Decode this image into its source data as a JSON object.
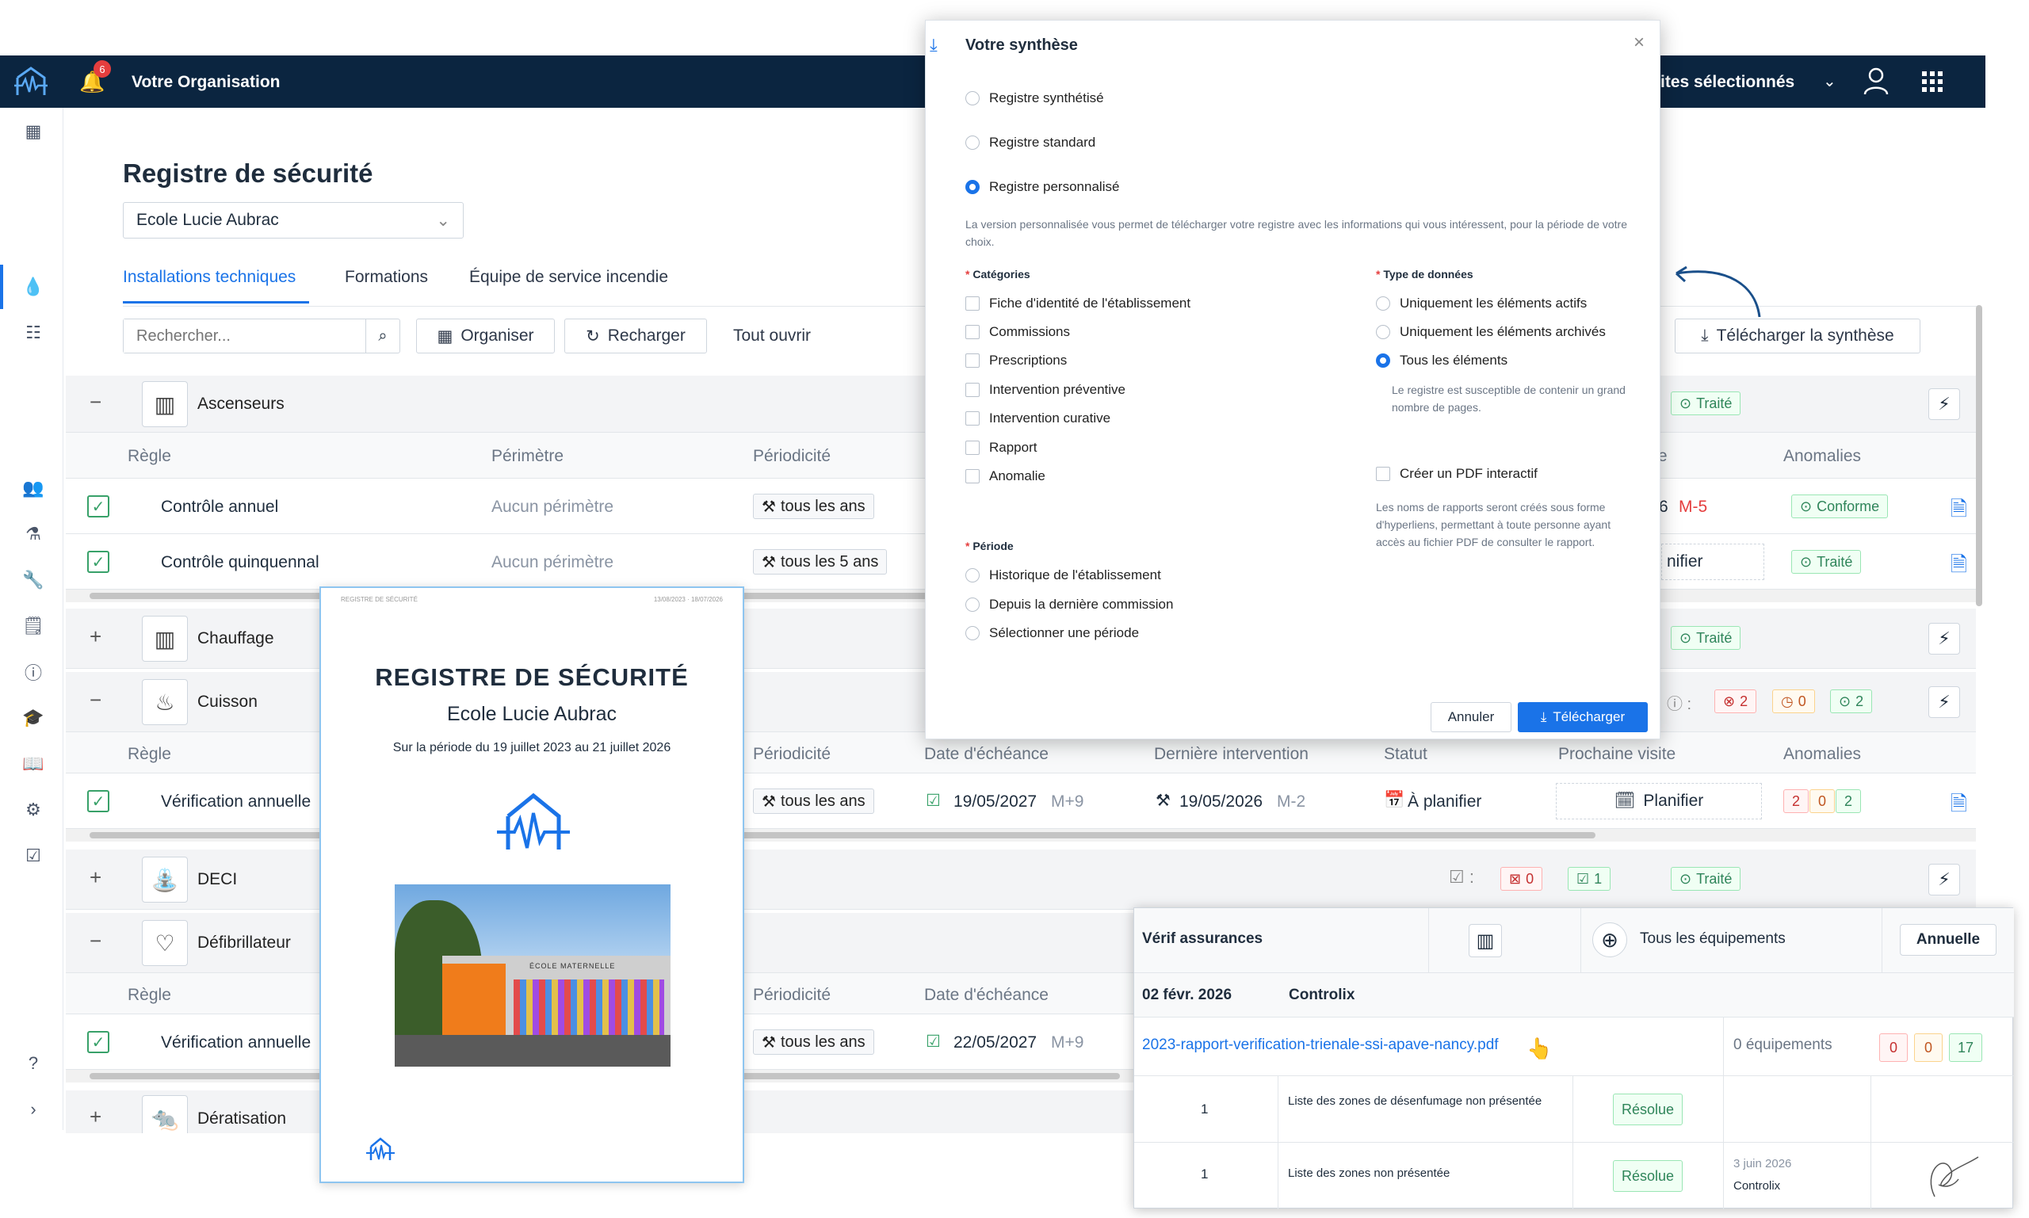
{
  "topbar": {
    "notifications_count": "6",
    "org": "Votre Organisation",
    "sites": "ites sélectionnés"
  },
  "page": {
    "title": "Registre de sécurité",
    "site_select": "Ecole Lucie Aubrac"
  },
  "tabs": [
    "Installations techniques",
    "Formations",
    "Équipe de service incendie"
  ],
  "toolbar": {
    "search_placeholder": "Rechercher...",
    "organize": "Organiser",
    "reload": "Recharger",
    "open_all": "Tout ouvrir",
    "download": "Télécharger la synthèse"
  },
  "columns": {
    "rule": "Règle",
    "perimeter": "Périmètre",
    "periodicity": "Périodicité",
    "due": "Date d'échéance",
    "last": "Dernière intervention",
    "status": "Statut",
    "next": "Prochaine visite",
    "anomalies": "Anomalies",
    "te": "te"
  },
  "groups": {
    "ascenseurs": "Ascenseurs",
    "chauffage": "Chauffage",
    "cuisson": "Cuisson",
    "deci": "DECI",
    "defib": "Défibrillateur",
    "derat": "Dératisation"
  },
  "rows": {
    "asc1": {
      "rule": "Contrôle annuel",
      "perimeter": "Aucun périmètre",
      "period": "tous les ans",
      "date_tail": "6",
      "m": "M-5",
      "badge": "Conforme"
    },
    "asc2": {
      "rule": "Contrôle quinquennal",
      "perimeter": "Aucun périmètre",
      "period": "tous les 5 ans",
      "next_tail": "nifier",
      "badge": "Traité"
    },
    "cui1": {
      "rule": "Vérification annuelle",
      "period": "tous les ans",
      "due": "19/05/2027",
      "due_m": "M+9",
      "last": "19/05/2026",
      "last_m": "M-2",
      "status": "À planifier",
      "next": "Planifier",
      "a1": "2",
      "a2": "0",
      "a3": "2"
    },
    "def1": {
      "rule": "Vérification annuelle",
      "period": "tous les ans",
      "due": "22/05/2027",
      "due_m": "M+9"
    }
  },
  "badges": {
    "traite": "Traité",
    "cuisson_a": "2",
    "cuisson_b": "0",
    "cuisson_c": "2",
    "deci_a": "0",
    "deci_b": "1"
  },
  "modal": {
    "title": "Votre synthèse",
    "opt1": "Registre synthétisé",
    "opt2": "Registre standard",
    "opt3": "Registre personnalisé",
    "desc": "La version personnalisée vous permet de télécharger votre registre avec les informations qui vous intéressent, pour la période de votre choix.",
    "cat_title": "Catégories",
    "categories": [
      "Fiche d'identité de l'établissement",
      "Commissions",
      "Prescriptions",
      "Intervention préventive",
      "Intervention curative",
      "Rapport",
      "Anomalie"
    ],
    "type_title": "Type de données",
    "types": [
      "Uniquement les éléments actifs",
      "Uniquement les éléments archivés",
      "Tous les éléments"
    ],
    "type_note": "Le registre est susceptible de contenir un grand nombre de pages.",
    "pdf": "Créer un PDF interactif",
    "pdf_note": "Les noms de rapports seront créés sous forme d'hyperliens, permettant à toute personne ayant accès au fichier PDF de consulter le rapport.",
    "period_title": "Période",
    "periods": [
      "Historique de l'établissement",
      "Depuis la dernière commission",
      "Sélectionner une période"
    ],
    "cancel": "Annuler",
    "download": "Télécharger"
  },
  "doc": {
    "header_left": "REGISTRE DE SÉCURITÉ",
    "header_right": "13/08/2023 · 18/07/2026",
    "title": "REGISTRE DE SÉCURITÉ",
    "subtitle": "Ecole Lucie Aubrac",
    "period": "Sur la période du 19 juillet 2023 au 21 juillet 2026",
    "sign": "ÉCOLE MATERNELLE"
  },
  "panel": {
    "title": "Vérif assurances",
    "scope": "Tous les équipements",
    "freq": "Annuelle",
    "date": "02 févr. 2026",
    "org": "Controlix",
    "link": "2023-rapport-verification-trienale-ssi-apave-nancy.pdf",
    "equip": "0 équipements",
    "n1": "0",
    "n2": "0",
    "n3": "17",
    "items": [
      {
        "n": "1",
        "text": "Liste des zones de désenfumage non présentée",
        "status": "Résolue"
      },
      {
        "n": "1",
        "text": "Liste des zones non présentée",
        "status": "Résolue",
        "date": "3 juin 2026",
        "by": "Controlix"
      }
    ]
  }
}
